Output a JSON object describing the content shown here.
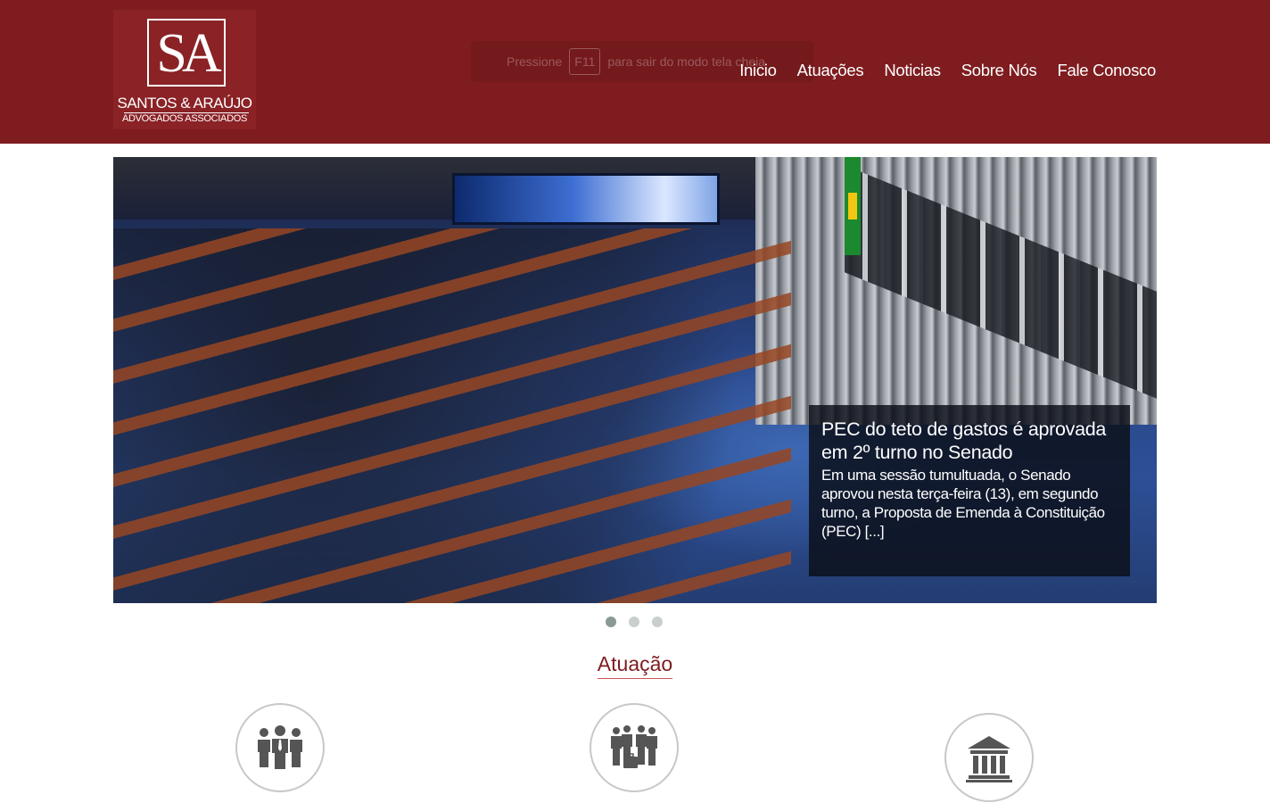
{
  "brand": {
    "mark": "SA",
    "name": "SANTOS & ARAÚJO",
    "tagline": "ADVOGADOS ASSOCIADOS"
  },
  "fullscreen_notice": {
    "before": "Pressione",
    "key": "F11",
    "after": "para sair do modo tela cheia"
  },
  "nav": {
    "items": [
      {
        "label": "Inicio"
      },
      {
        "label": "Atuações"
      },
      {
        "label": "Noticias"
      },
      {
        "label": "Sobre Nós"
      },
      {
        "label": "Fale Conosco"
      }
    ]
  },
  "slider": {
    "caption_title": "PEC do teto de gastos é aprovada em 2º turno no Senado",
    "caption_text": "Em uma sessão tumultuada, o Senado aprovou nesta terça-feira (13), em segundo turno, a Proposta de Emenda à Constituição (PEC) [...]",
    "slide_count": 3,
    "active_slide": 1
  },
  "section": {
    "title": "Atuação"
  },
  "icons": [
    "group-people-icon",
    "business-people-icon",
    "courthouse-icon"
  ],
  "colors": {
    "brand": "#7e1c1f",
    "dot_active": "#8a9996",
    "dot_inactive": "#c8cfcd"
  }
}
